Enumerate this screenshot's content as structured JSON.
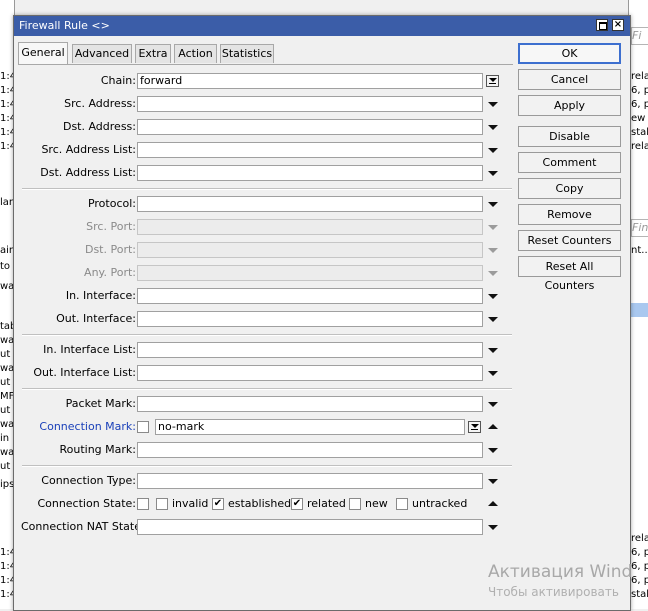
{
  "window": {
    "title": "Firewall Rule <>",
    "close_glyph": "×"
  },
  "tabs": [
    {
      "label": "General"
    },
    {
      "label": "Advanced"
    },
    {
      "label": "Extra"
    },
    {
      "label": "Action"
    },
    {
      "label": "Statistics"
    }
  ],
  "fields": {
    "chain": {
      "label": "Chain:",
      "value": "forward"
    },
    "src_address": {
      "label": "Src. Address:",
      "value": ""
    },
    "dst_address": {
      "label": "Dst. Address:",
      "value": ""
    },
    "src_address_list": {
      "label": "Src. Address List:",
      "value": ""
    },
    "dst_address_list": {
      "label": "Dst. Address List:",
      "value": ""
    },
    "protocol": {
      "label": "Protocol:",
      "value": ""
    },
    "src_port": {
      "label": "Src. Port:",
      "value": ""
    },
    "dst_port": {
      "label": "Dst. Port:",
      "value": ""
    },
    "any_port": {
      "label": "Any. Port:",
      "value": ""
    },
    "in_interface": {
      "label": "In. Interface:",
      "value": ""
    },
    "out_interface": {
      "label": "Out. Interface:",
      "value": ""
    },
    "in_interface_list": {
      "label": "In. Interface List:",
      "value": ""
    },
    "out_interface_list": {
      "label": "Out. Interface List:",
      "value": ""
    },
    "packet_mark": {
      "label": "Packet Mark:",
      "value": ""
    },
    "connection_mark": {
      "label": "Connection Mark:",
      "value": "no-mark"
    },
    "routing_mark": {
      "label": "Routing Mark:",
      "value": ""
    },
    "connection_type": {
      "label": "Connection Type:",
      "value": ""
    },
    "connection_state": {
      "label": "Connection State:"
    },
    "connection_nat_state": {
      "label": "Connection NAT State:",
      "value": ""
    }
  },
  "connection_states": [
    {
      "label": "invalid",
      "checked": false,
      "mark": ""
    },
    {
      "label": "established",
      "checked": true,
      "mark": "✔"
    },
    {
      "label": "related",
      "checked": true,
      "mark": "✔"
    },
    {
      "label": "new",
      "checked": false,
      "mark": ""
    },
    {
      "label": "untracked",
      "checked": false,
      "mark": ""
    }
  ],
  "buttons": {
    "ok": "OK",
    "cancel": "Cancel",
    "apply": "Apply",
    "disable": "Disable",
    "comment": "Comment",
    "copy": "Copy",
    "remove": "Remove",
    "reset_counters": "Reset Counters",
    "reset_all_counters": "Reset All Counters"
  },
  "background": {
    "left_rows": [
      "1:4",
      "1:4",
      "1:4",
      "1:4",
      "1:4",
      "1:4",
      "lan",
      "ain",
      "to",
      "wa",
      "tab",
      "wa",
      "ut",
      "wa",
      "ut",
      "MF",
      "ut",
      "wa",
      "in",
      "wa",
      "ut",
      "ips",
      "1:4",
      "1:4",
      "1:4",
      "1:4"
    ],
    "right_rows": [
      "rela",
      "6, pr",
      "6, pr",
      "ew s",
      "stabl",
      "rela",
      "6, pr",
      "6, pr",
      "6, pr",
      "stabl",
      "rela"
    ],
    "search_placeholder_top": "Fi",
    "search_placeholder_mid": "Find",
    "right_mid_text": "nt..."
  },
  "watermark": {
    "line1": "Активация Wind",
    "line2": "Чтобы активировать"
  },
  "colors": {
    "titlebar": "#3b5da8",
    "accent_label": "#1b41b9",
    "default_button_border": "#3d6fcf"
  }
}
